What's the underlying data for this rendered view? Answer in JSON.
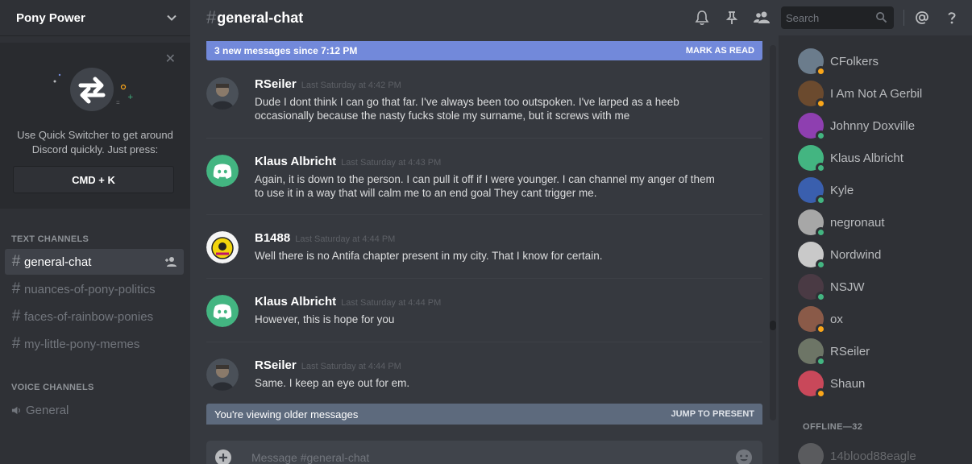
{
  "server": {
    "name": "Pony Power"
  },
  "quick_switcher": {
    "text": "Use Quick Switcher to get around Discord quickly. Just press:",
    "shortcut": "CMD + K"
  },
  "categories": {
    "text": "TEXT CHANNELS",
    "voice": "VOICE CHANNELS"
  },
  "text_channels": [
    {
      "name": "general-chat",
      "active": true
    },
    {
      "name": "nuances-of-pony-politics",
      "active": false
    },
    {
      "name": "faces-of-rainbow-ponies",
      "active": false
    },
    {
      "name": "my-little-pony-memes",
      "active": false
    }
  ],
  "voice_channels": [
    {
      "name": "General"
    }
  ],
  "header": {
    "hash": "#",
    "channel": "general-chat",
    "search_placeholder": "Search"
  },
  "new_messages_bar": {
    "text": "3 new messages since 7:12 PM",
    "action": "MARK AS READ"
  },
  "messages": [
    {
      "author": "RSeiler",
      "time": "Last Saturday at 4:42 PM",
      "text": "Dude I dont think I can go that far.  I've always been too outspoken.  I've larped as a heeb occasionally because the nasty fucks stole my surname, but it screws with me",
      "avatar": "photo-dark"
    },
    {
      "author": "Klaus Albricht",
      "time": "Last Saturday at 4:43 PM",
      "text": "Again, it is down to the person. I can pull it off if I were younger. I can channel my anger of them to use it in a way that will calm me to an end goal They cant trigger me.",
      "avatar": "discord-default-teal"
    },
    {
      "author": "B1488",
      "time": "Last Saturday at 4:44 PM",
      "text": "Well there is no Antifa chapter present in my city. That I know for certain.",
      "avatar": "yellow-emblem"
    },
    {
      "author": "Klaus Albricht",
      "time": "Last Saturday at 4:44 PM",
      "text": "However, this is hope for you",
      "avatar": "discord-default-teal"
    },
    {
      "author": "RSeiler",
      "time": "Last Saturday at 4:44 PM",
      "text": "Same.  I keep an eye out for em.",
      "avatar": "photo-dark"
    }
  ],
  "older_bar": {
    "text": "You're viewing older messages",
    "action": "JUMP TO PRESENT"
  },
  "composer": {
    "placeholder": "Message #general-chat"
  },
  "members": [
    {
      "name": "CFolkers",
      "status": "idle",
      "color": "#6b7c8c"
    },
    {
      "name": "I Am Not A Gerbil",
      "status": "idle",
      "color": "#6b4a2e"
    },
    {
      "name": "Johnny Doxville",
      "status": "online",
      "color": "#8e3fb0"
    },
    {
      "name": "Klaus Albricht",
      "status": "online",
      "color": "#43b581"
    },
    {
      "name": "Kyle",
      "status": "online",
      "color": "#3a5fae"
    },
    {
      "name": "negronaut",
      "status": "online",
      "color": "#a7a7a7"
    },
    {
      "name": "Nordwind",
      "status": "online",
      "color": "#c9c9c9"
    },
    {
      "name": "NSJW",
      "status": "online",
      "color": "#4a3a44"
    },
    {
      "name": "ox",
      "status": "idle",
      "color": "#8a5a48"
    },
    {
      "name": "RSeiler",
      "status": "online",
      "color": "#6d7566"
    },
    {
      "name": "Shaun",
      "status": "idle",
      "color": "#c9485a"
    }
  ],
  "offline": {
    "label": "OFFLINE—32",
    "first_member": "14blood88eagle"
  },
  "colors": {
    "online": "#43b581",
    "idle": "#faa61a",
    "accent": "#7289da"
  }
}
